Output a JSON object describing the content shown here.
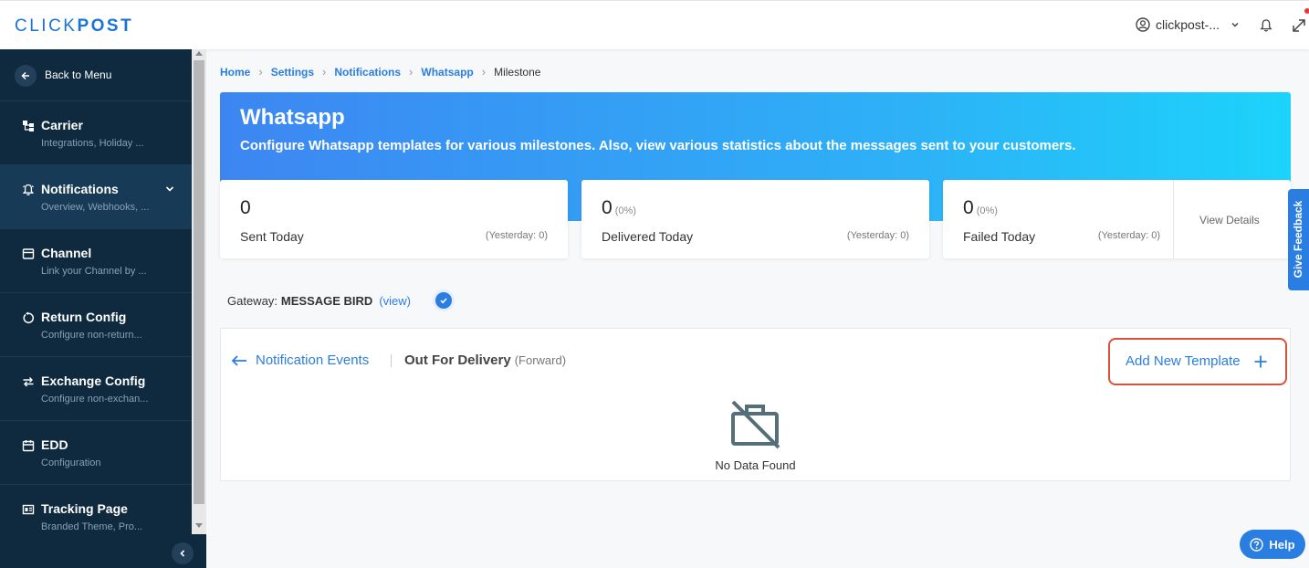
{
  "header": {
    "logo_light": "CLICK",
    "logo_bold": "POST",
    "user_label": "clickpost-..."
  },
  "sidebar": {
    "back_label": "Back to Menu",
    "items": [
      {
        "title": "Carrier",
        "subtitle": "Integrations, Holiday ...",
        "icon": "carrier-icon"
      },
      {
        "title": "Notifications",
        "subtitle": "Overview, Webhooks, ...",
        "icon": "bell-icon",
        "active": true
      },
      {
        "title": "Channel",
        "subtitle": "Link your Channel by ...",
        "icon": "store-icon"
      },
      {
        "title": "Return Config",
        "subtitle": "Configure non-return...",
        "icon": "return-icon"
      },
      {
        "title": "Exchange Config",
        "subtitle": "Configure non-exchan...",
        "icon": "exchange-icon"
      },
      {
        "title": "EDD",
        "subtitle": "Configuration",
        "icon": "calendar-icon"
      },
      {
        "title": "Tracking Page",
        "subtitle": "Branded Theme, Pro...",
        "icon": "tracking-icon"
      }
    ]
  },
  "breadcrumb": [
    "Home",
    "Settings",
    "Notifications",
    "Whatsapp",
    "Milestone"
  ],
  "banner": {
    "title": "Whatsapp",
    "description": "Configure Whatsapp templates for various milestones. Also, view various statistics about the messages sent to your customers."
  },
  "stats": [
    {
      "value": "0",
      "percent": "",
      "label": "Sent Today",
      "yesterday": "(Yesterday: 0)"
    },
    {
      "value": "0",
      "percent": "(0%)",
      "label": "Delivered Today",
      "yesterday": "(Yesterday: 0)"
    },
    {
      "value": "0",
      "percent": "(0%)",
      "label": "Failed Today",
      "yesterday": "(Yesterday: 0)"
    }
  ],
  "view_details": "View Details",
  "feedback": "Give Feedback",
  "gateway": {
    "label": "Gateway:",
    "name": "MESSAGE BIRD",
    "link": "(view)"
  },
  "panel": {
    "back_label": "Notification Events",
    "event": "Out For Delivery",
    "direction": "(Forward)",
    "add_template": "Add New Template",
    "empty_text": "No Data Found"
  },
  "help": "Help",
  "colors": {
    "sidebar_bg": "#0f2a3f",
    "accent": "#2a7de1",
    "highlight_border": "#d9523a"
  }
}
